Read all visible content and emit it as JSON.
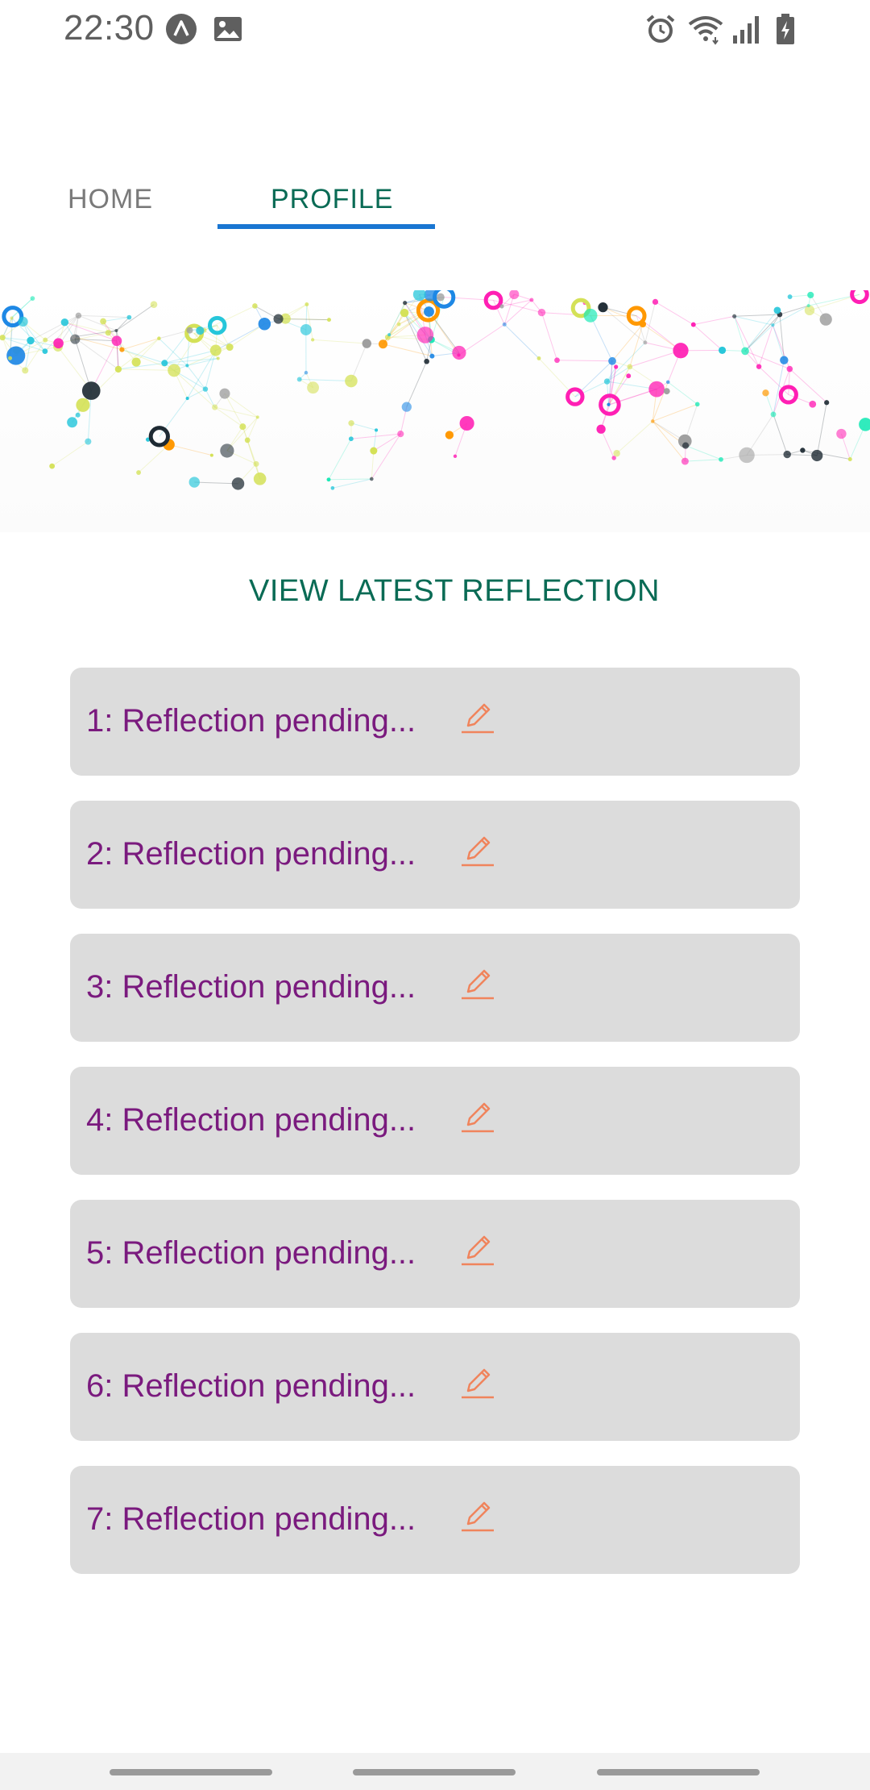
{
  "status_bar": {
    "time": "22:30",
    "left_icons": [
      "app-a-icon",
      "image-icon"
    ],
    "right_icons": [
      "alarm-icon",
      "wifi-icon",
      "signal-icon",
      "battery-charging-icon"
    ]
  },
  "tabs": [
    {
      "label": "HOME",
      "active": false
    },
    {
      "label": "PROFILE",
      "active": true
    }
  ],
  "colors": {
    "active_tab_text": "#0a6b55",
    "tab_indicator": "#1976d2",
    "card_background": "#dcdcdc",
    "card_text": "#7a1a7e",
    "edit_icon": "#f0845c"
  },
  "banner": {
    "image": "colorful-network-nodes"
  },
  "view_latest_label": "VIEW LATEST REFLECTION",
  "reflections": [
    {
      "label": "1: Reflection pending...",
      "icon": "pencil-icon"
    },
    {
      "label": "2: Reflection pending...",
      "icon": "pencil-icon"
    },
    {
      "label": "3: Reflection pending...",
      "icon": "pencil-icon"
    },
    {
      "label": "4: Reflection pending...",
      "icon": "pencil-icon"
    },
    {
      "label": "5: Reflection pending...",
      "icon": "pencil-icon"
    },
    {
      "label": "6: Reflection pending...",
      "icon": "pencil-icon"
    },
    {
      "label": "7: Reflection pending...",
      "icon": "pencil-icon"
    }
  ]
}
